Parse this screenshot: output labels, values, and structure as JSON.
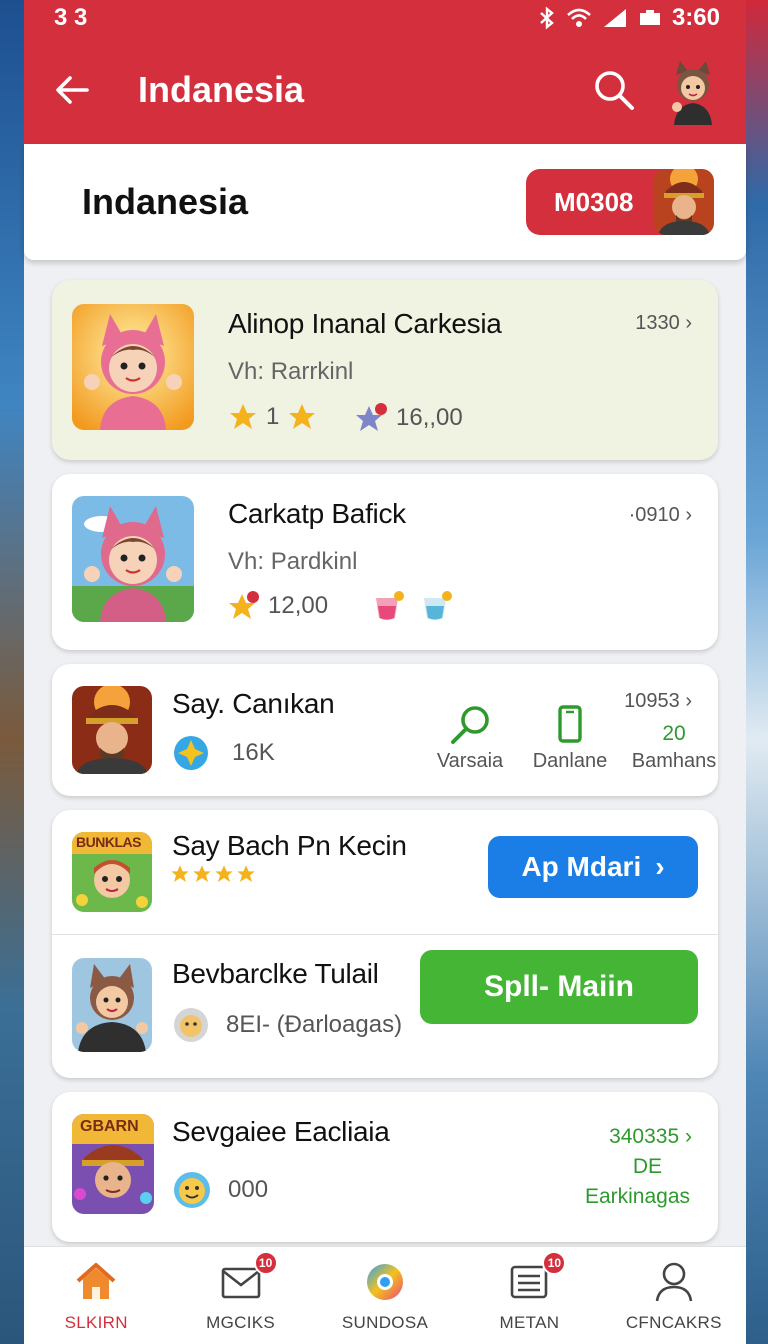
{
  "status_bar": {
    "left": "3 3",
    "time": "3:60"
  },
  "app_bar": {
    "title": "Indanesia"
  },
  "header": {
    "title": "Indanesia",
    "coin_label": "M0308"
  },
  "items": [
    {
      "name": "Alinop Inanal Carkesia",
      "sub": "Vh: Rarrkinl",
      "meta": "1330",
      "rating_count": "1",
      "stat": "16,,00"
    },
    {
      "name": "Carkatp Bafick",
      "sub": "Vh: Pardkinl",
      "meta": "·0910",
      "stat": "12,00"
    },
    {
      "name": "Say. Canıkan",
      "stat": "16K",
      "meta": "10953",
      "actions": [
        {
          "label": "Varsaia"
        },
        {
          "label": "Danlane"
        },
        {
          "value": "20",
          "label": "Bamhans"
        }
      ]
    },
    {
      "name": "Say Bach Pn Kecin",
      "thumb_label": "BUNKLAS",
      "button": "Ap Mdari"
    },
    {
      "name": "Bevbarclke Tulail",
      "stat": "8EI- (Ðarloagas)",
      "button": "Spll- Maiin"
    },
    {
      "name": "Sevgaiee Eacliaia",
      "thumb_label": "GBARN",
      "stat": "000",
      "meta": "340335",
      "meta2": "DE",
      "meta3": "Earkinagas"
    }
  ],
  "bottom_nav": [
    {
      "label": "SLKIRN",
      "icon": "home-icon",
      "active": true
    },
    {
      "label": "MGCIKS",
      "icon": "mail-icon",
      "badge": "10"
    },
    {
      "label": "SUNDOSA",
      "icon": "orb-icon"
    },
    {
      "label": "METAN",
      "icon": "list-icon",
      "badge": "10"
    },
    {
      "label": "CFNCAKRS",
      "icon": "person-icon"
    }
  ],
  "colors": {
    "primary": "#d42f3d",
    "blue": "#1a7ee6",
    "green": "#45b535",
    "link_green": "#2e9a2e"
  }
}
